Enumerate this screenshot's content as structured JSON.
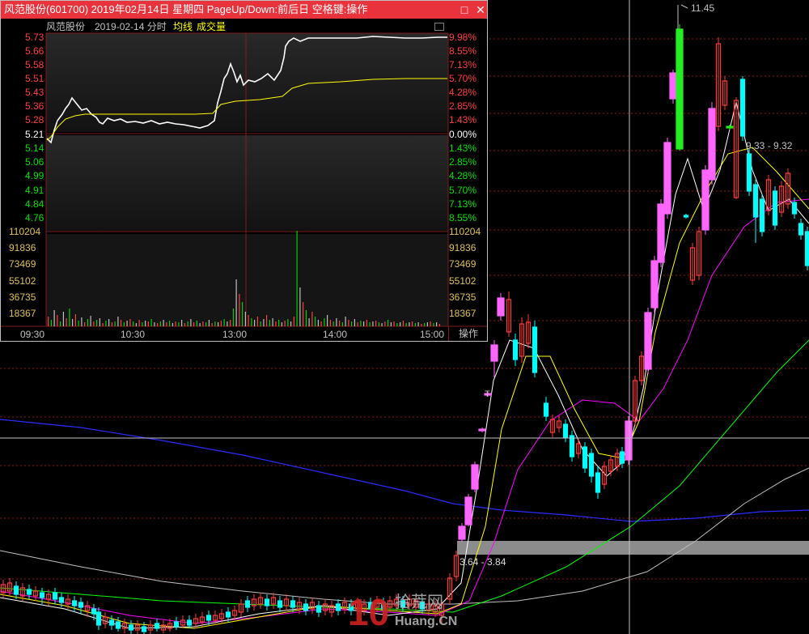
{
  "window": {
    "title": "风范股份(601700)  2019年02月14日  星期四  PageUp/Down:前后日  空格键:操作",
    "minimize_glyph": "□",
    "close_glyph": "✕"
  },
  "intraday_header": {
    "name": "风范股份",
    "date_label": "2019-02-14 分时",
    "avg_label": "均线",
    "volume_label": "成交量"
  },
  "price_axis": {
    "left_up": [
      "5.73",
      "5.66",
      "5.58",
      "5.51",
      "5.43",
      "5.36",
      "5.28"
    ],
    "prev_close": "5.21",
    "left_down": [
      "5.14",
      "5.06",
      "4.99",
      "4.91",
      "4.84",
      "4.76"
    ],
    "right_up": [
      "9.98%",
      "8.55%",
      "7.13%",
      "5.70%",
      "4.28%",
      "2.85%",
      "1.43%"
    ],
    "zero": "0.00%",
    "right_down": [
      "1.43%",
      "2.85%",
      "4.28%",
      "5.70%",
      "7.13%",
      "8.55%"
    ]
  },
  "volume_axis": {
    "labels": [
      "110204",
      "91836",
      "73469",
      "55102",
      "36735",
      "18367"
    ]
  },
  "time_axis": [
    "09:30",
    "10:30",
    "13:00",
    "14:00",
    "15:00"
  ],
  "footer": {
    "operate_label": "操作"
  },
  "kline_annotations": {
    "high_label": "11.45",
    "range_upper": "9.33 - 9.32",
    "range_lower": "3.64 - 3.84",
    "cursor_mark": "T"
  },
  "watermark": {
    "big": "10",
    "cn": "拾荒网",
    "url": "Huang.CN"
  },
  "colors": {
    "up": "#ff3c3c",
    "down": "#00ffff",
    "limit_up_bar": "#ff66ff",
    "ma5": "#ffffff",
    "ma10": "#ffff00",
    "ma20": "#ff00ff",
    "ma60": "#00ff00",
    "ma120": "#c0c0c0",
    "ma250": "#2b2bff",
    "title_bar": "#e8323c",
    "grid": "#8b1a1a"
  }
}
